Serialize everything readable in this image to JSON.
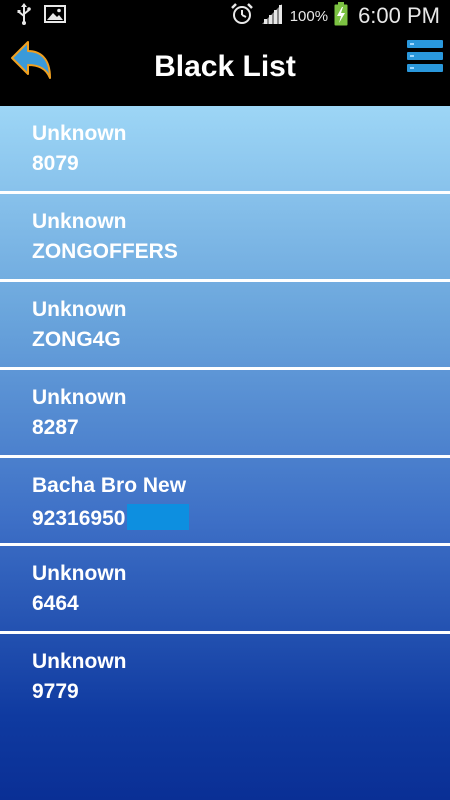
{
  "status_bar": {
    "battery_percent": "100%",
    "time": "6:00 PM"
  },
  "header": {
    "title": "Black List",
    "back_icon": "back-arrow-icon",
    "menu_icon": "list-menu-icon"
  },
  "colors": {
    "header_background": "#000000",
    "list_gradient_top": "#9dd6f6",
    "list_gradient_bottom": "#0a2f95",
    "divider": "#ffffff",
    "text": "#ffffff",
    "back_arrow": "#3a9ad9",
    "back_arrow_accent": "#f0a020"
  },
  "blacklist": [
    {
      "name": "Unknown",
      "number": "8079"
    },
    {
      "name": "Unknown",
      "number": "ZONGOFFERS"
    },
    {
      "name": "Unknown",
      "number": "ZONG4G"
    },
    {
      "name": "Unknown",
      "number": "8287"
    },
    {
      "name": "Bacha Bro New",
      "number": "92316950"
    },
    {
      "name": "Unknown",
      "number": "6464"
    },
    {
      "name": "Unknown",
      "number": "9779"
    }
  ]
}
